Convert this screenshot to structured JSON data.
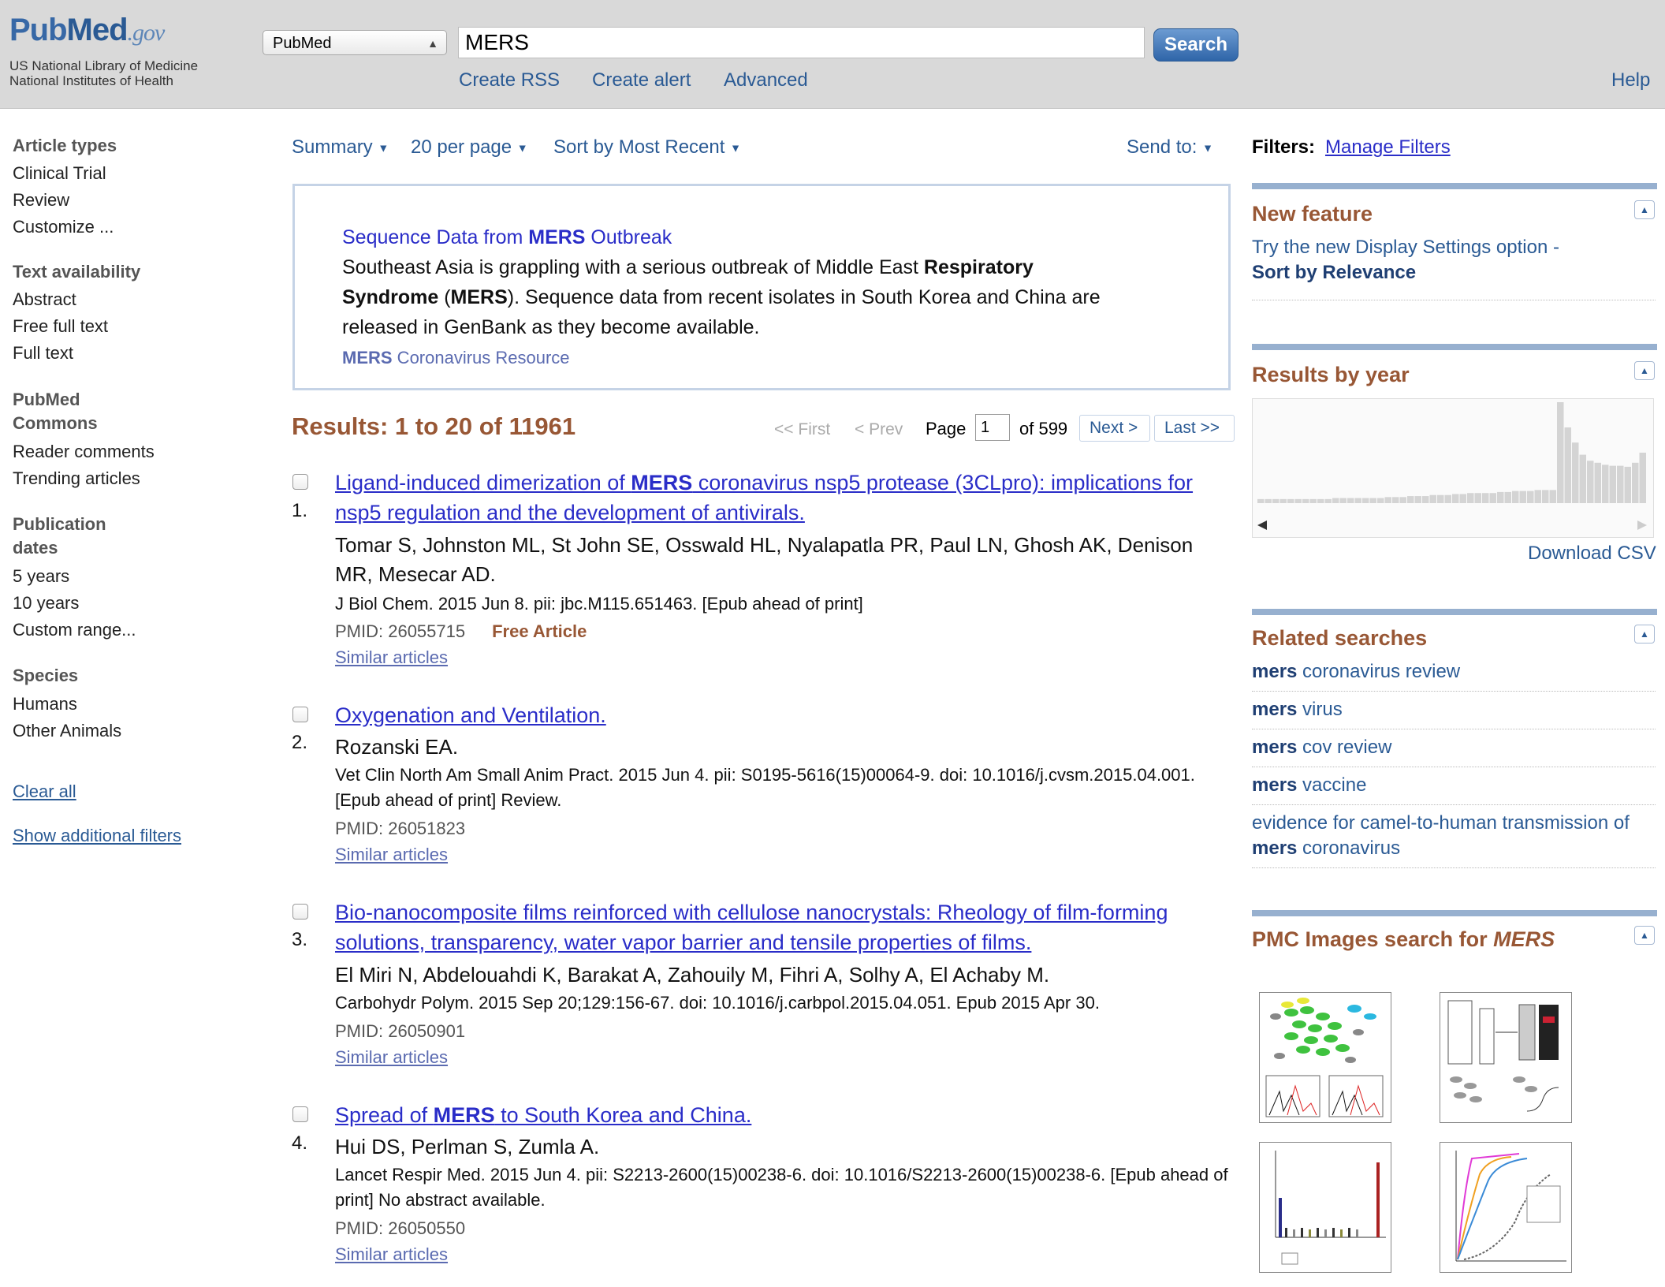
{
  "header": {
    "logo": {
      "word_a": "Pub",
      "word_b": "Med",
      "word_c": ".gov",
      "line1": "US National Library of Medicine",
      "line2": "National Institutes of Health"
    },
    "db_select": "PubMed",
    "search_value": "MERS",
    "search_button": "Search",
    "links": {
      "rss": "Create RSS",
      "alert": "Create alert",
      "advanced": "Advanced",
      "help": "Help"
    }
  },
  "sidebar": {
    "article_types": {
      "label": "Article types",
      "items": [
        "Clinical Trial",
        "Review",
        "Customize ..."
      ]
    },
    "text_availability": {
      "label": "Text availability",
      "items": [
        "Abstract",
        "Free full text",
        "Full text"
      ]
    },
    "commons": {
      "label1": "PubMed",
      "label2": "Commons",
      "items": [
        "Reader comments",
        "Trending articles"
      ]
    },
    "pub_dates": {
      "label1": "Publication",
      "label2": "dates",
      "items": [
        "5 years",
        "10 years",
        "Custom range..."
      ]
    },
    "species": {
      "label": "Species",
      "items": [
        "Humans",
        "Other Animals"
      ]
    },
    "clear_all": "Clear all",
    "show_filters": "Show additional filters"
  },
  "toolbar": {
    "format": "Summary",
    "per_page": "20 per page",
    "sort": "Sort by Most Recent",
    "send_to": "Send to:"
  },
  "notice": {
    "title_a": "Sequence Data from ",
    "title_b": "MERS",
    "title_c": " Outbreak",
    "p1": "Southeast Asia is grappling with a serious outbreak of Middle East ",
    "p2": "Respiratory",
    "p3": "Syndrome",
    "p4": " (",
    "p5": "MERS",
    "p6": "). Sequence data from recent isolates in South Korea and China are",
    "p7": "released in GenBank as they become available.",
    "link_a": "MERS",
    "link_b": " Coronavirus Resource"
  },
  "results": {
    "title": "Results: 1 to 20 of 11961",
    "pager": {
      "first": "<< First",
      "prev": "< Prev",
      "page_label": "Page",
      "page_value": "1",
      "of": "of 599",
      "next": "Next >",
      "last": "Last >>"
    },
    "items": [
      {
        "num": "1.",
        "title_line1_a": "Ligand-induced dimerization of ",
        "title_line1_b": "MERS",
        "title_line1_c": " coronavirus nsp5 protease (3CLpro): implications for",
        "title_line2": "nsp5 regulation and the development of antivirals.",
        "authors": "Tomar S, Johnston ML, St John SE, Osswald HL, Nyalapatla PR, Paul LN, Ghosh AK, Denison MR, Mesecar AD.",
        "source": "J Biol Chem. 2015 Jun 8. pii: jbc.M115.651463. [Epub ahead of print]",
        "pmid": "PMID: 26055715",
        "free": "Free Article",
        "similar": "Similar articles"
      },
      {
        "num": "2.",
        "title": "Oxygenation and Ventilation.",
        "authors": "Rozanski EA.",
        "source": "Vet Clin North Am Small Anim Pract. 2015 Jun 4. pii: S0195-5616(15)00064-9. doi: 10.1016/j.cvsm.2015.04.001. [Epub ahead of print] Review.",
        "pmid": "PMID: 26051823",
        "similar": "Similar articles"
      },
      {
        "num": "3.",
        "title": "Bio-nanocomposite films reinforced with cellulose nanocrystals: Rheology of film-forming solutions, transparency, water vapor barrier and tensile properties of films.",
        "authors": "El Miri N, Abdelouahdi K, Barakat A, Zahouily M, Fihri A, Solhy A, El Achaby M.",
        "source": "Carbohydr Polym. 2015 Sep 20;129:156-67. doi: 10.1016/j.carbpol.2015.04.051. Epub 2015 Apr 30.",
        "pmid": "PMID: 26050901",
        "similar": "Similar articles"
      },
      {
        "num": "4.",
        "title_a": "Spread of ",
        "title_b": "MERS",
        "title_c": " to South Korea and China.",
        "authors": "Hui DS, Perlman S, Zumla A.",
        "source": "Lancet Respir Med. 2015 Jun 4. pii: S2213-2600(15)00238-6. doi: 10.1016/S2213-2600(15)00238-6. [Epub ahead of print] No abstract available.",
        "pmid": "PMID: 26050550",
        "similar": "Similar articles"
      }
    ]
  },
  "right": {
    "filters_label": "Filters:",
    "manage_filters": "Manage Filters",
    "new_feature": {
      "title": "New feature",
      "text": "Try the new Display Settings option -",
      "link": "Sort by Relevance"
    },
    "results_by_year": {
      "title": "Results by year",
      "download": "Download CSV",
      "bar_levels": [
        0.04,
        0.04,
        0.04,
        0.04,
        0.04,
        0.04,
        0.04,
        0.04,
        0.04,
        0.04,
        0.05,
        0.05,
        0.05,
        0.05,
        0.05,
        0.05,
        0.05,
        0.06,
        0.06,
        0.06,
        0.07,
        0.07,
        0.07,
        0.08,
        0.08,
        0.08,
        0.09,
        0.09,
        0.1,
        0.1,
        0.1,
        0.1,
        0.11,
        0.11,
        0.12,
        0.12,
        0.12,
        0.13,
        0.13,
        0.13,
        1.0,
        0.75,
        0.6,
        0.48,
        0.42,
        0.4,
        0.38,
        0.37,
        0.37,
        0.36,
        0.4,
        0.5
      ]
    },
    "related": {
      "title": "Related searches",
      "items": [
        {
          "a": "mers",
          "b": " coronavirus review"
        },
        {
          "a": "mers",
          "b": " virus"
        },
        {
          "a": "mers",
          "b": " cov review"
        },
        {
          "a": "mers",
          "b": " vaccine"
        },
        {
          "pre": "evidence for camel-to-human transmission of ",
          "a": "mers",
          "b": " coronavirus"
        }
      ]
    },
    "pmc": {
      "title_a": "PMC Images search for ",
      "title_b": "MERS"
    }
  }
}
